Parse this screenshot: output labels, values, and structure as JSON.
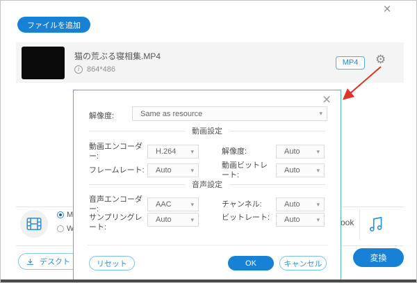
{
  "window": {
    "add_file_button": "ファイルを追加"
  },
  "icons": {
    "close": "×",
    "gear": "⚙",
    "chevron": "▾",
    "info": "i"
  },
  "file_item": {
    "name": "猫の荒ぶる寝相集.MP4",
    "resolution": "864*486",
    "format_badge": "MP4"
  },
  "output_bar": {
    "radio1_label": "M",
    "radio2_label": "W",
    "truncated_text": "ook",
    "desktop_button_label": "デスクト",
    "convert_button_label": "変換"
  },
  "dialog": {
    "resolution_label": "解像度:",
    "resolution_value": "Same as resource",
    "video_section_title": "動画設定",
    "audio_section_title": "音声設定",
    "video_fields": [
      {
        "label": "動画エンコーダー:",
        "value": "H.264"
      },
      {
        "label": "解像度:",
        "value": "Auto"
      },
      {
        "label": "フレームレート:",
        "value": "Auto"
      },
      {
        "label": "動画ビットレート:",
        "value": "Auto"
      }
    ],
    "audio_fields": [
      {
        "label": "音声エンコーダー:",
        "value": "AAC"
      },
      {
        "label": "チャンネル:",
        "value": "Auto"
      },
      {
        "label": "サンプリングレート:",
        "value": "Auto"
      },
      {
        "label": "ビットレート:",
        "value": "Auto"
      }
    ],
    "reset_button": "リセット",
    "ok_button": "OK",
    "cancel_button": "キャンセル"
  },
  "colors": {
    "primary_blue": "#1781d6",
    "outline_blue": "#2f93d8",
    "dialog_border_teal": "#50b6ba",
    "annotation_red": "#e03427"
  }
}
